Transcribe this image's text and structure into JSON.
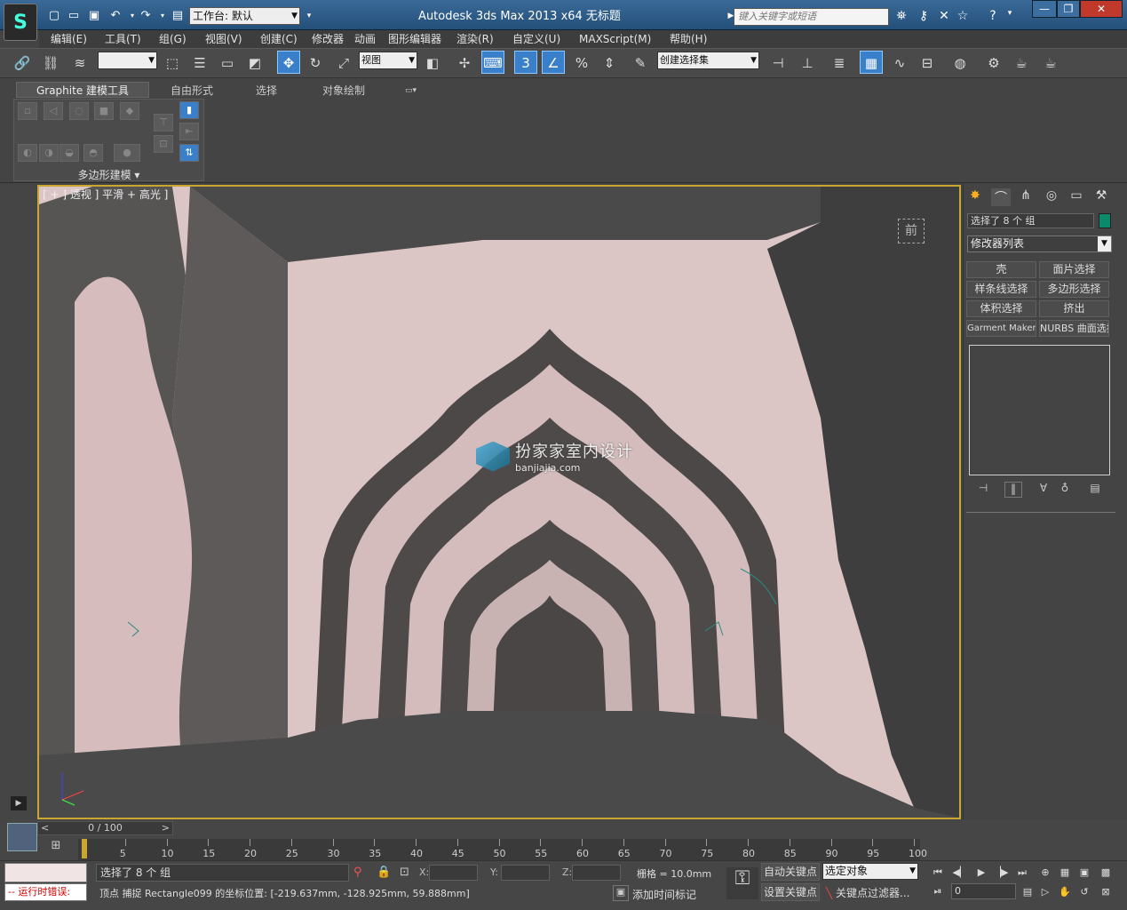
{
  "titlebar": {
    "workspace_label": "工作台: 默认",
    "title": "Autodesk 3ds Max  2013 x64        无标题",
    "search_placeholder": "键入关键字或短语"
  },
  "menu": [
    "编辑(E)",
    "工具(T)",
    "组(G)",
    "视图(V)",
    "创建(C)",
    "修改器",
    "动画",
    "图形编辑器",
    "渲染(R)",
    "自定义(U)",
    "MAXScript(M)",
    "帮助(H)"
  ],
  "toolbar": {
    "view_dropdown": "视图",
    "selection_set": "创建选择集",
    "snap_value": "3"
  },
  "ribbon": {
    "tabs": [
      "Graphite 建模工具",
      "自由形式",
      "选择",
      "对象绘制"
    ],
    "panel_label": "多边形建模 ▾"
  },
  "viewport": {
    "label": "[ + ] 透视 ] 平滑 + 高光 ]",
    "viewcube_label": "前",
    "watermark_main": "扮家家室内设计",
    "watermark_sub": "banjiajia.com"
  },
  "command_panel": {
    "selection": "选择了 8 个 组",
    "modifier_list": "修改器列表",
    "buttons": [
      "壳",
      "面片选择",
      "样条线选择",
      "多边形选择",
      "体积选择",
      "挤出",
      "Garment Maker",
      "NURBS 曲面选择"
    ],
    "selection_color": "#0a8a6a"
  },
  "timeline": {
    "slider": "0 / 100",
    "ticks": [
      "5",
      "10",
      "15",
      "20",
      "25",
      "30",
      "35",
      "40",
      "45",
      "50",
      "55",
      "60",
      "65",
      "70",
      "75",
      "80",
      "85",
      "90",
      "95",
      "100"
    ]
  },
  "status": {
    "maxscript_error": "-- 运行时错误:",
    "selection": "选择了 8 个 组",
    "prompt": "顶点 捕捉 Rectangle099 的坐标位置: [-219.637mm, -128.925mm, 59.888mm]",
    "x_label": "X:",
    "y_label": "Y:",
    "z_label": "Z:",
    "grid": "栅格 = 10.0mm",
    "auto_key": "自动关键点",
    "set_key": "设置关键点",
    "selected_object": "选定对象",
    "key_filter": "关键点过滤器...",
    "add_time_tag": "添加时间标记",
    "frame": "0"
  }
}
